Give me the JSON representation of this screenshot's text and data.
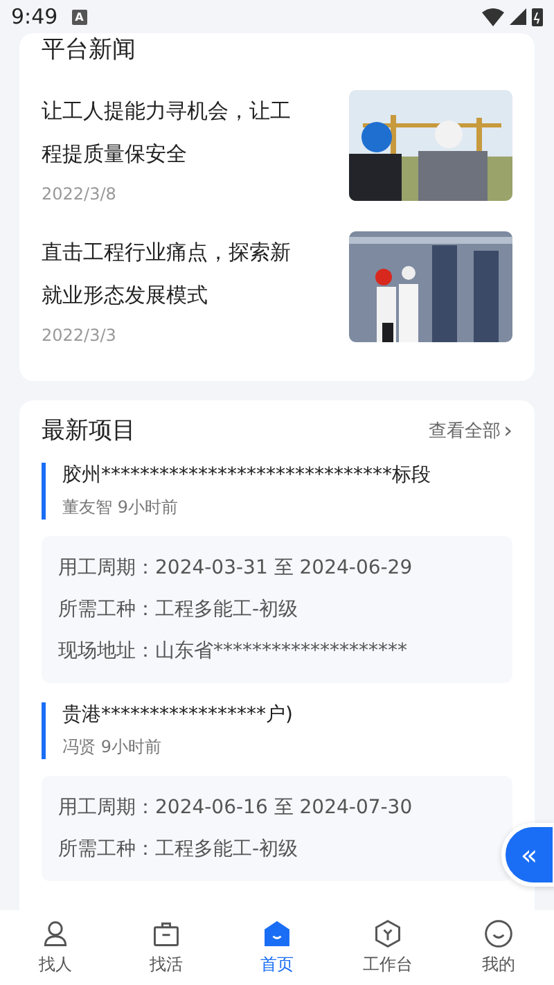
{
  "status_bar": {
    "time": "9:49",
    "badge": "A"
  },
  "news": {
    "title": "平台新闻",
    "items": [
      {
        "headline": "让工人提能力寻机会，让工程提质量保安全",
        "date": "2022/3/8"
      },
      {
        "headline": "直击工程行业痛点，探索新就业形态发展模式",
        "date": "2022/3/3"
      }
    ]
  },
  "projects": {
    "title": "最新项目",
    "view_all": "查看全部",
    "caret": "›",
    "items": [
      {
        "name": "胶州******************************标段",
        "poster": "董友智",
        "time": "9小时前",
        "details": [
          {
            "label": "用工周期：",
            "value": "2024-03-31 至 2024-06-29"
          },
          {
            "label": "所需工种：",
            "value": "工程多能工-初级"
          },
          {
            "label": "现场地址：",
            "value": "山东省********************"
          }
        ]
      },
      {
        "name": "贵港*****************户)",
        "poster": "冯贤",
        "time": "9小时前",
        "details": [
          {
            "label": "用工周期：",
            "value": "2024-06-16 至 2024-07-30"
          },
          {
            "label": "所需工种：",
            "value": "工程多能工-初级"
          }
        ]
      }
    ]
  },
  "float_button": {
    "label": "«"
  },
  "tabs": [
    {
      "label": "找人",
      "kind": "person",
      "selected": false
    },
    {
      "label": "找活",
      "kind": "briefcase",
      "selected": false
    },
    {
      "label": "首页",
      "kind": "home",
      "selected": true
    },
    {
      "label": "工作台",
      "kind": "hexagon",
      "selected": false
    },
    {
      "label": "我的",
      "kind": "smile",
      "selected": false
    }
  ]
}
